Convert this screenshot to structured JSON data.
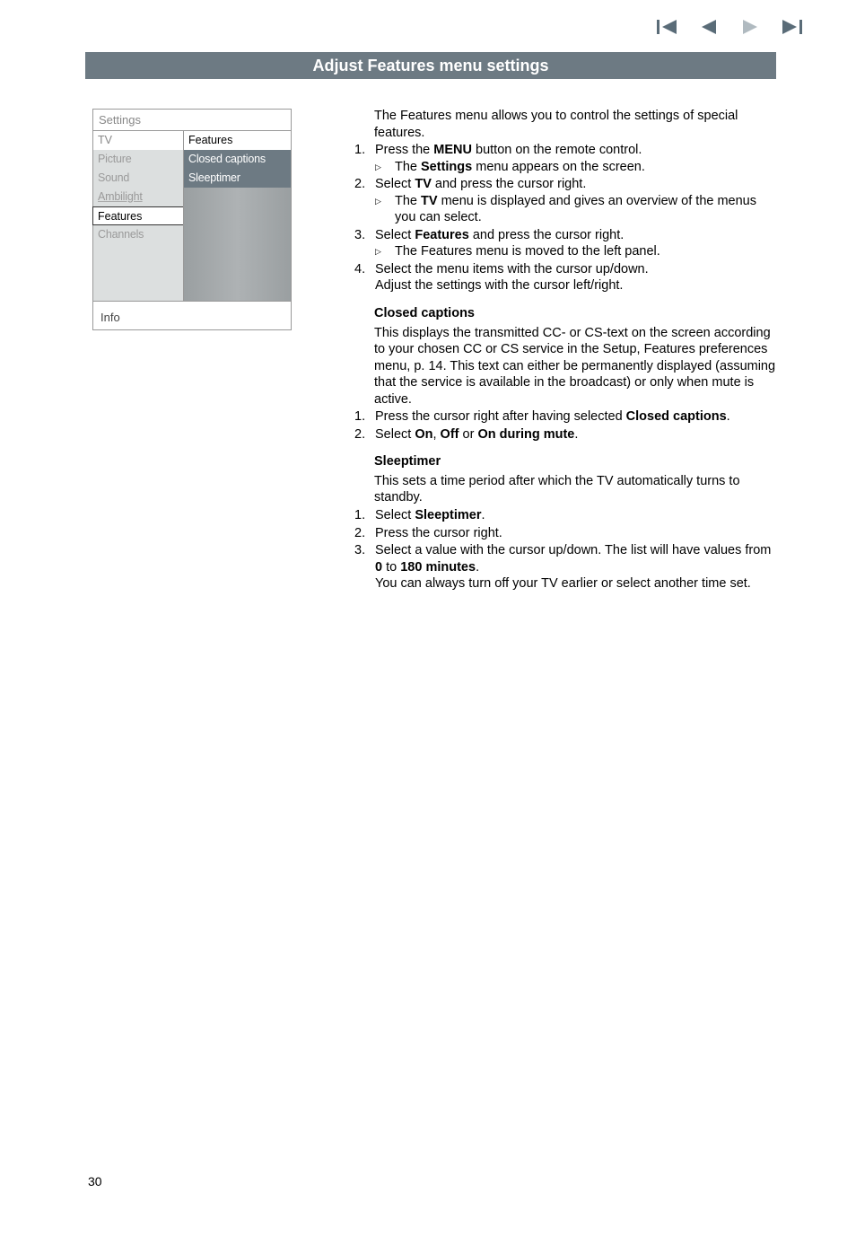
{
  "nav": {
    "first": "⏮",
    "prev": "◀",
    "next": "▶",
    "last": "⏭"
  },
  "banner": "Adjust Features menu settings",
  "panel": {
    "title": "Settings",
    "left_head": "TV",
    "left": [
      "Picture",
      "Sound",
      "Ambilight",
      "Features",
      "Channels"
    ],
    "right_head": "Features",
    "right": [
      "Closed captions",
      "Sleeptimer"
    ],
    "info": "Info"
  },
  "intro": {
    "p1": "The Features menu allows you to control the settings of special features.",
    "steps": [
      {
        "n": "1.",
        "t": [
          "Press the ",
          "MENU",
          " button on the remote control."
        ],
        "sub": [
          "The ",
          "Settings",
          " menu appears on the screen."
        ]
      },
      {
        "n": "2.",
        "t": [
          "Select ",
          "TV",
          " and press the cursor right."
        ],
        "sub": [
          "The ",
          "TV",
          " menu is displayed and gives an overview of the menus you can select."
        ]
      },
      {
        "n": "3.",
        "t": [
          "Select ",
          "Features",
          " and press the cursor right."
        ],
        "sub2": "The Features menu is moved to the left panel."
      },
      {
        "n": "4.",
        "t": [
          "Select the menu items with the cursor up/down."
        ],
        "plain": "Adjust the settings with the cursor left/right."
      }
    ]
  },
  "closed": {
    "head": "Closed captions",
    "p": "This displays the transmitted CC- or CS-text on the screen according to your chosen CC or CS service in the Setup, Features preferences menu, p. 14. This text can either be permanently displayed (assuming that the service is available in the broadcast) or only when mute is active.",
    "s1a": "Press the cursor right after having selected ",
    "s1b": "Closed captions",
    "s1c": ".",
    "s2a": "Select ",
    "s2b": "On",
    "s2c": ", ",
    "s2d": "Off",
    "s2e": " or ",
    "s2f": "On during mute",
    "s2g": "."
  },
  "sleep": {
    "head": "Sleeptimer",
    "p": "This sets a time period after which the TV automatically turns to standby.",
    "s1a": "Select ",
    "s1b": "Sleeptimer",
    "s1c": ".",
    "s2": "Press the cursor right.",
    "s3a": "Select a value with the cursor up/down. The list will have values from ",
    "s3b": "0",
    "s3c": " to ",
    "s3d": "180 minutes",
    "s3e": ".",
    "s3f": "You can always turn off your TV earlier or select another time set."
  },
  "page": "30"
}
